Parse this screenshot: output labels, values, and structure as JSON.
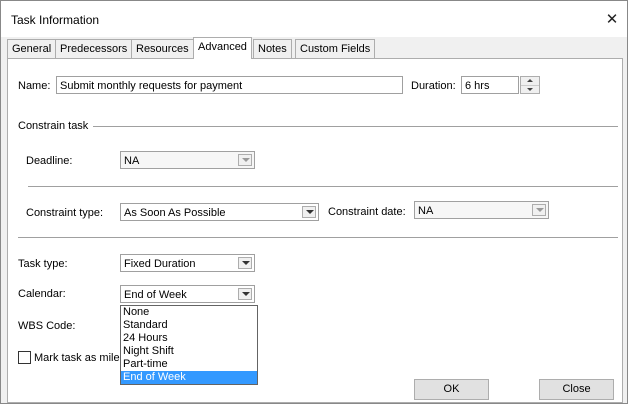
{
  "window": {
    "title": "Task Information",
    "close_glyph": "✕"
  },
  "tabs": [
    {
      "label": "General"
    },
    {
      "label": "Predecessors"
    },
    {
      "label": "Resources"
    },
    {
      "label": "Advanced",
      "active": true
    },
    {
      "label": "Notes"
    },
    {
      "label": "Custom Fields"
    }
  ],
  "form": {
    "name_label": "Name:",
    "name_value": "Submit monthly requests for payment",
    "duration_label": "Duration:",
    "duration_value": "6 hrs",
    "constrain_heading": "Constrain task",
    "deadline_label": "Deadline:",
    "deadline_value": "NA",
    "constraint_type_label": "Constraint type:",
    "constraint_type_value": "As Soon As Possible",
    "constraint_date_label": "Constraint date:",
    "constraint_date_value": "NA",
    "task_type_label": "Task type:",
    "task_type_value": "Fixed Duration",
    "calendar_label": "Calendar:",
    "calendar_value": "End of Week",
    "wbs_label": "WBS Code:",
    "milestone_label": "Mark task as mile"
  },
  "calendar_options": [
    "None",
    "Standard",
    "24 Hours",
    "Night Shift",
    "Part-time",
    "End of Week"
  ],
  "calendar_selected": "End of Week",
  "buttons": {
    "ok": "OK",
    "close": "Close"
  },
  "icons": {
    "close": "close-icon",
    "dropdown": "chevron-down-icon",
    "spinner": "spinner-arrows-icon"
  },
  "colors": {
    "selection": "#3399ff",
    "panel": "#ffffff",
    "window": "#f0f0f0"
  }
}
